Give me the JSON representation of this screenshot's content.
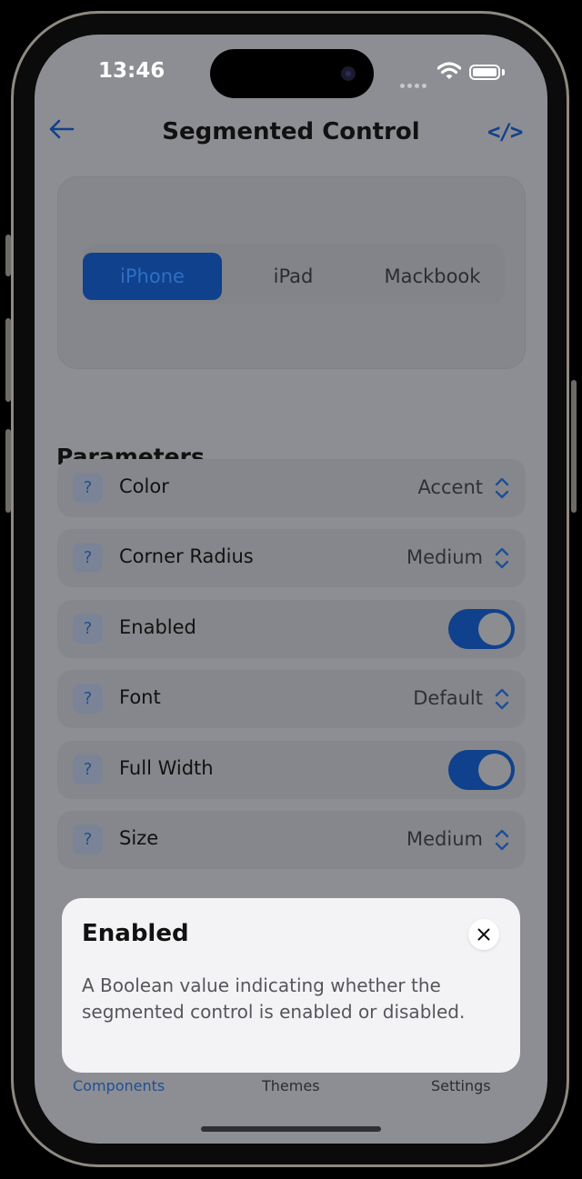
{
  "status_bar": {
    "time": "13:46"
  },
  "nav": {
    "title": "Segmented Control",
    "back_icon": "arrow-left-icon",
    "code_icon": "code-brackets-icon",
    "code_glyph": "</>"
  },
  "preview": {
    "segments": [
      {
        "label": "iPhone",
        "selected": true
      },
      {
        "label": "iPad",
        "selected": false
      },
      {
        "label": "Mackbook",
        "selected": false
      }
    ]
  },
  "parameters": {
    "title": "Parameters",
    "help_glyph": "?",
    "rows": [
      {
        "label": "Color",
        "value": "Accent"
      },
      {
        "label": "Corner Radius",
        "value": "Medium"
      },
      {
        "label": "Enabled",
        "toggle": true
      },
      {
        "label": "Font",
        "value": "Default"
      },
      {
        "label": "Full Width",
        "toggle": true
      },
      {
        "label": "Size",
        "value": "Medium"
      }
    ]
  },
  "tab_bar": {
    "items": [
      {
        "label": "Components",
        "active": true
      },
      {
        "label": "Themes",
        "active": false
      },
      {
        "label": "Settings",
        "active": false
      }
    ]
  },
  "sheet": {
    "title": "Enabled",
    "body": "A Boolean value indicating whether the segmented control is enabled or disabled.",
    "close_icon": "close-icon"
  },
  "colors": {
    "accent": "#10418c",
    "dim_overlay_bg": "#8d8e93",
    "sheet_bg": "#f3f3f5"
  }
}
